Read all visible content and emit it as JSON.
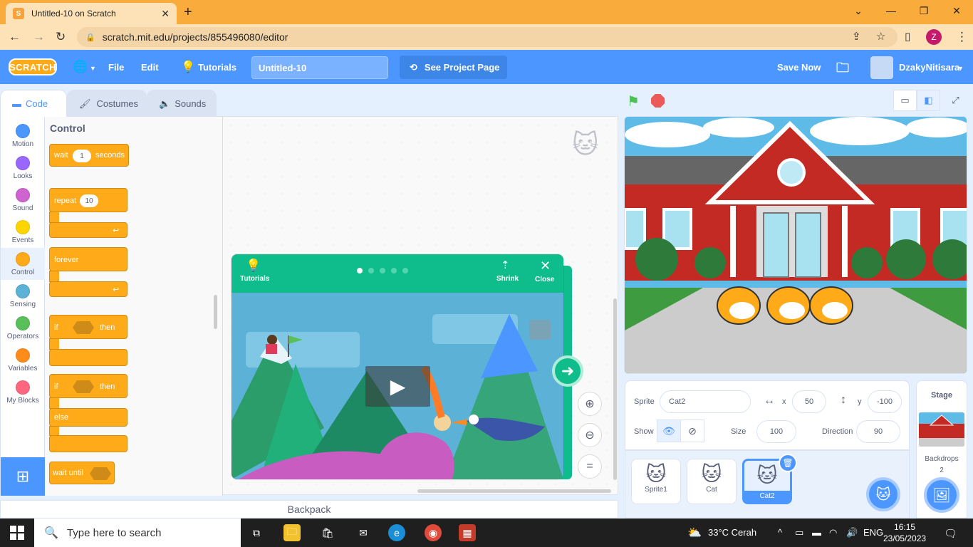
{
  "browser": {
    "tab_title": "Untitled-10 on Scratch",
    "tab_favicon": "S",
    "url": "scratch.mit.edu/projects/855496080/editor",
    "profile_letter": "Z",
    "new_tab": "+",
    "minimize": "⌄",
    "window_min": "—",
    "window_max": "❐",
    "window_close": "✕"
  },
  "menubar": {
    "logo": "SCRATCH",
    "file": "File",
    "edit": "Edit",
    "tutorials": "Tutorials",
    "project_title": "Untitled-10",
    "see_project_page": "See Project Page",
    "save_now": "Save Now",
    "username": "DzakyNitisara"
  },
  "editor_tabs": {
    "code": "Code",
    "costumes": "Costumes",
    "sounds": "Sounds"
  },
  "categories": [
    {
      "label": "Motion",
      "color": "#4c97ff"
    },
    {
      "label": "Looks",
      "color": "#9966ff"
    },
    {
      "label": "Sound",
      "color": "#cf63cf"
    },
    {
      "label": "Events",
      "color": "#ffd500"
    },
    {
      "label": "Control",
      "color": "#ffab19"
    },
    {
      "label": "Sensing",
      "color": "#5cb1d6"
    },
    {
      "label": "Operators",
      "color": "#59c059"
    },
    {
      "label": "Variables",
      "color": "#ff8c1a"
    },
    {
      "label": "My Blocks",
      "color": "#ff6680"
    }
  ],
  "palette": {
    "title": "Control",
    "wait_label": "wait",
    "wait_value": "1",
    "wait_unit": "seconds",
    "repeat_label": "repeat",
    "repeat_value": "10",
    "forever_label": "forever",
    "if_label": "if",
    "then_label": "then",
    "else_label": "else",
    "wait_until_label": "wait until"
  },
  "tutorial": {
    "tutorials_label": "Tutorials",
    "shrink_label": "Shrink",
    "close_label": "Close",
    "page_count": 5,
    "current_page": 1
  },
  "backpack": "Backpack",
  "sprite_info": {
    "sprite_label": "Sprite",
    "sprite_name": "Cat2",
    "x_label": "x",
    "x_value": "50",
    "y_label": "y",
    "y_value": "-100",
    "show_label": "Show",
    "size_label": "Size",
    "size_value": "100",
    "direction_label": "Direction",
    "direction_value": "90"
  },
  "sprites": [
    {
      "name": "Sprite1"
    },
    {
      "name": "Cat"
    },
    {
      "name": "Cat2"
    }
  ],
  "stage_panel": {
    "title": "Stage",
    "backdrops_label": "Backdrops",
    "backdrops_count": "2"
  },
  "taskbar": {
    "search_placeholder": "Type here to search",
    "weather": "33°C  Cerah",
    "language": "ENG",
    "time": "16:15",
    "date": "23/05/2023"
  }
}
